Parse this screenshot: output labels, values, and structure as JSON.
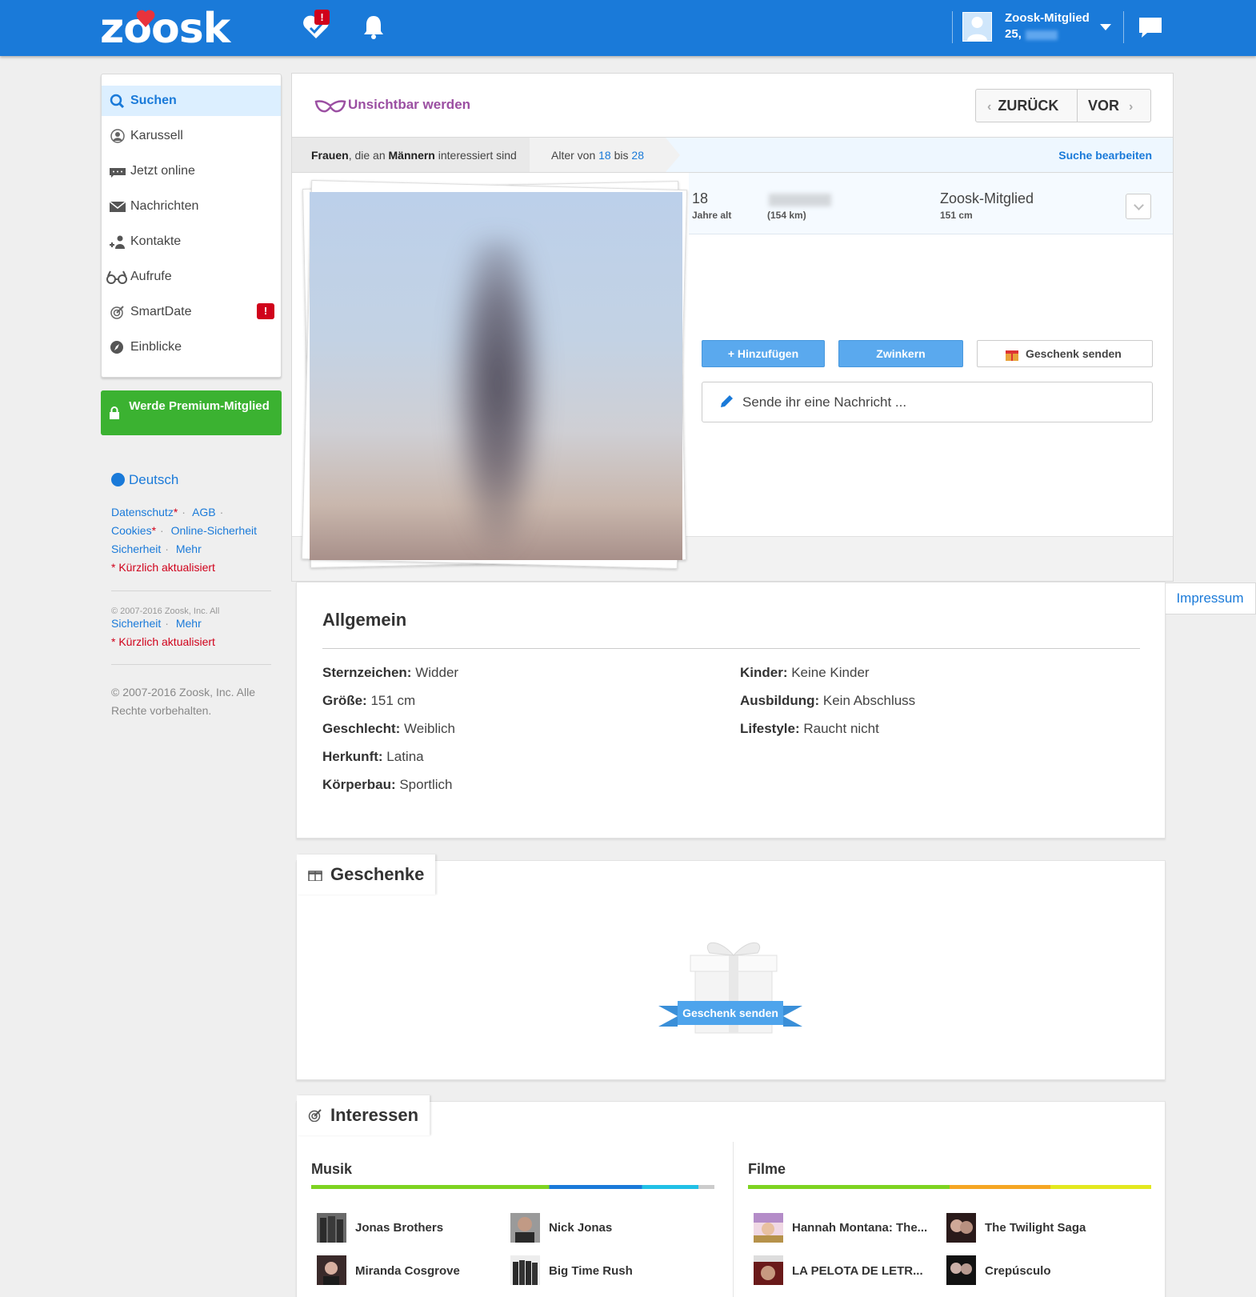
{
  "header": {
    "logo": "zoosk",
    "notification_badge": "!",
    "user_name": "Zoosk-Mitglied",
    "user_age": "25,"
  },
  "sidebar": {
    "items": [
      {
        "label": "Suchen",
        "icon": "search-icon",
        "active": true
      },
      {
        "label": "Karussell",
        "icon": "carousel-icon"
      },
      {
        "label": "Jetzt online",
        "icon": "online-icon"
      },
      {
        "label": "Nachrichten",
        "icon": "envelope-icon"
      },
      {
        "label": "Kontakte",
        "icon": "contacts-icon"
      },
      {
        "label": "Aufrufe",
        "icon": "glasses-icon"
      },
      {
        "label": "SmartDate",
        "icon": "target-icon",
        "alert": "!"
      },
      {
        "label": "Einblicke",
        "icon": "compass-icon"
      }
    ],
    "premium_label": "Werde Premium-Mitglied",
    "language": "Deutsch",
    "footer_links": {
      "privacy": "Datenschutz",
      "terms": "AGB",
      "cookies": "Cookies",
      "online_safety": "Online-Sicherheit",
      "more": "Mehr",
      "asterisk": "*",
      "recently_updated": "* Kürzlich aktualisiert",
      "safety_short": "Sicherheit",
      "more2": "Mehr",
      "recently_updated2": "* Kürzlich aktualisiert",
      "truncated_copyright": "© 2007-2016 Zoosk, Inc. All"
    },
    "copyright": "© 2007-2016 Zoosk, Inc. Alle Rechte vorbehalten."
  },
  "profile": {
    "invisible_label": "Unsichtbar werden",
    "back_label": "ZURÜCK",
    "next_label": "VOR",
    "filter": {
      "women": "Frauen",
      "interested_text": ", die an ",
      "men": "Männern",
      "interested_suffix": " interessiert sind",
      "age_prefix": "Alter von ",
      "age_from": "18",
      "age_mid": " bis ",
      "age_to": "28",
      "edit_label": "Suche bearbeiten"
    },
    "age": "18",
    "age_label": "Jahre alt",
    "distance": "(154 km)",
    "member_label": "Zoosk-Mitglied",
    "height": "151 cm",
    "add_label": "+ Hinzufügen",
    "wink_label": "Zwinkern",
    "gift_label": "Geschenk senden",
    "message_placeholder": "Sende ihr eine Nachricht ..."
  },
  "impressum": "Impressum",
  "general": {
    "title": "Allgemein",
    "left": [
      {
        "key": "Sternzeichen:",
        "value": " Widder"
      },
      {
        "key": "Größe:",
        "value": " 151 cm"
      },
      {
        "key": "Geschlecht:",
        "value": " Weiblich"
      },
      {
        "key": "Herkunft:",
        "value": " Latina"
      },
      {
        "key": "Körperbau:",
        "value": " Sportlich"
      }
    ],
    "right": [
      {
        "key": "Kinder:",
        "value": " Keine Kinder"
      },
      {
        "key": "Ausbildung:",
        "value": " Kein Abschluss"
      },
      {
        "key": "Lifestyle:",
        "value": " Raucht nicht"
      }
    ]
  },
  "gifts": {
    "title": "Geschenke",
    "send_label": "Geschenk senden"
  },
  "interests": {
    "title": "Interessen",
    "music_title": "Musik",
    "movies_title": "Filme",
    "music": [
      "Jonas Brothers",
      "Nick Jonas",
      "Miranda Cosgrove",
      "Big Time Rush"
    ],
    "movies": [
      "Hannah Montana: The...",
      "The Twilight Saga",
      "LA PELOTA DE LETR...",
      "Crepúsculo"
    ]
  },
  "colors": {
    "brand_blue": "#1a7ad9",
    "premium_green": "#3bb231",
    "alert_red": "#d0021b",
    "invisible_purple": "#9b4fa2"
  }
}
